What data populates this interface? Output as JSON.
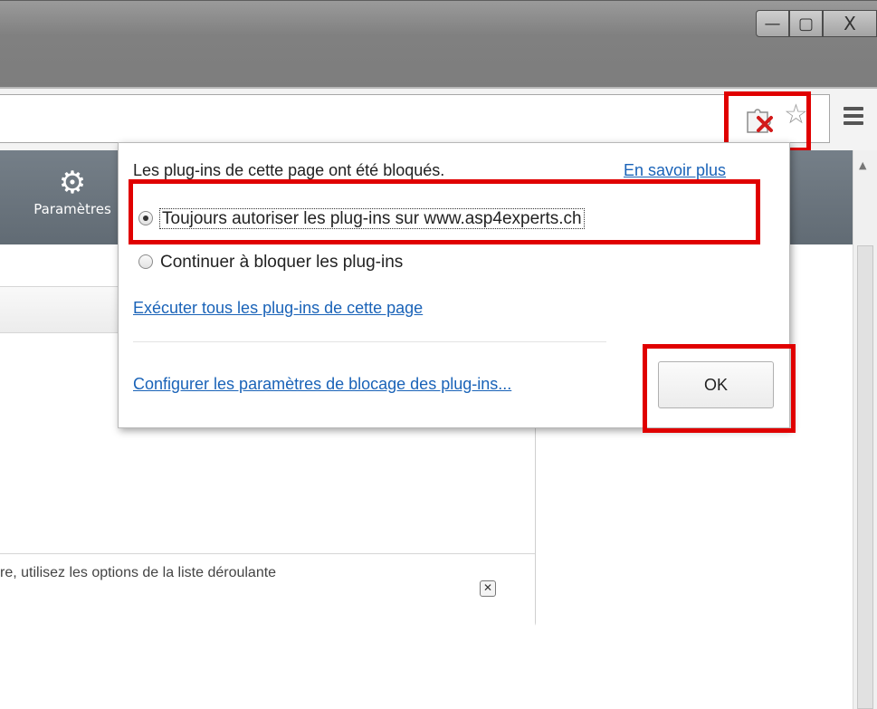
{
  "window": {
    "minimize_glyph": "—",
    "maximize_glyph": "▢",
    "close_glyph": "X"
  },
  "toolbar": {
    "plugin_blocked_icon": "puzzle-blocked-icon",
    "bookmark_icon": "star-icon",
    "menu_icon": "hamburger-menu-icon"
  },
  "settings_nav": {
    "icon": "gear-icon",
    "label": "Paramètres"
  },
  "notice": {
    "text": "re, utilisez les options de la liste déroulante",
    "close_glyph": "✕"
  },
  "bubble": {
    "title": "Les plug-ins de cette page ont été bloqués.",
    "learn_more": "En savoir plus",
    "options": [
      {
        "label": "Toujours autoriser les plug-ins sur www.asp4experts.ch",
        "selected": true
      },
      {
        "label": "Continuer à bloquer les plug-ins",
        "selected": false
      }
    ],
    "run_all_link": "Exécuter tous les plug-ins de cette page",
    "configure_link": "Configurer les paramètres de blocage des plug-ins...",
    "ok_label": "OK"
  },
  "colors": {
    "highlight": "#e00000",
    "link": "#1a63b8",
    "header": "#6b757e"
  }
}
